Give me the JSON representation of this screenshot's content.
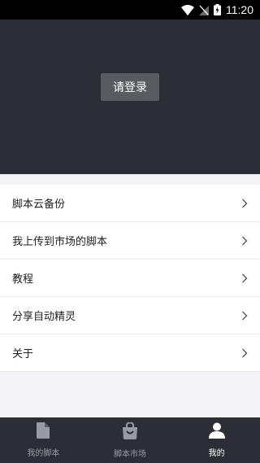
{
  "status_bar": {
    "time": "11:20",
    "icons": [
      "wifi-icon",
      "signal-icon",
      "battery-charging-icon"
    ]
  },
  "header": {
    "login_label": "请登录"
  },
  "menu": {
    "items": [
      {
        "label": "脚本云备份",
        "icon": "chevron-right-icon"
      },
      {
        "label": "我上传到市场的脚本",
        "icon": "chevron-right-icon"
      },
      {
        "label": "教程",
        "icon": "chevron-right-icon"
      },
      {
        "label": "分享自动精灵",
        "icon": "chevron-right-icon"
      },
      {
        "label": "关于",
        "icon": "chevron-right-icon"
      }
    ]
  },
  "bottom_nav": {
    "tabs": [
      {
        "label": "我的脚本",
        "icon": "document-icon",
        "active": false
      },
      {
        "label": "脚本市场",
        "icon": "shopping-bag-icon",
        "active": false
      },
      {
        "label": "我的",
        "icon": "user-icon",
        "active": true
      }
    ]
  },
  "colors": {
    "header_bg": "#2d2e35",
    "login_button_bg": "#5a5b60",
    "page_bg": "#f4f4f6",
    "nav_inactive": "#9a9ba2",
    "nav_active": "#ffffff"
  }
}
